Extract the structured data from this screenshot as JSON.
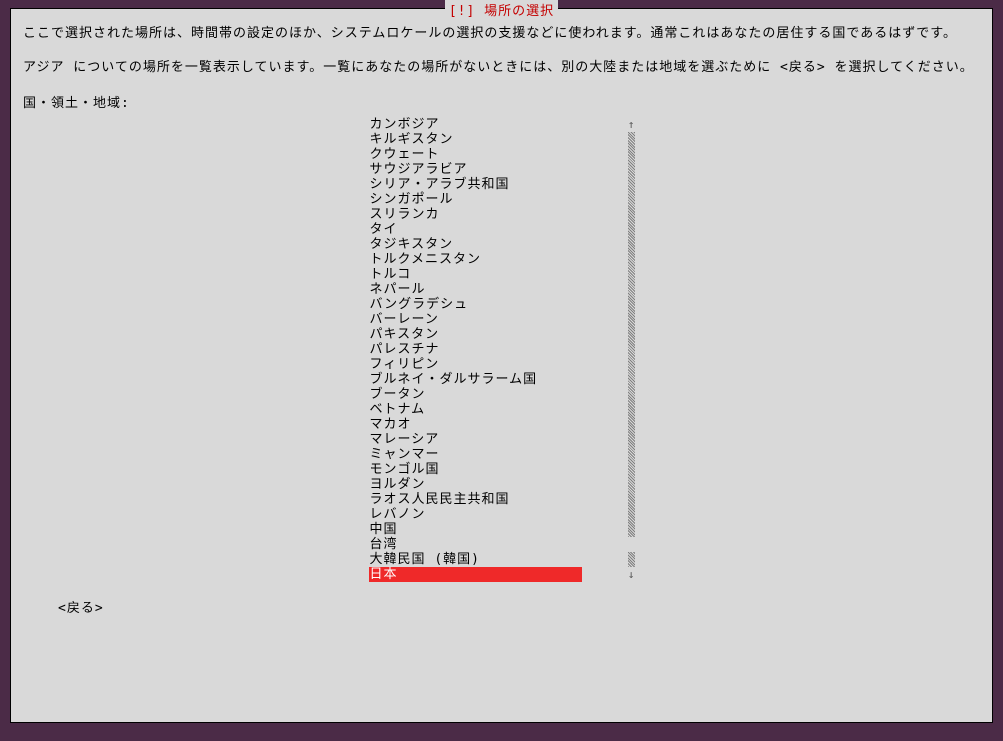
{
  "title": "[!] 場所の選択",
  "desc1": "ここで選択された場所は、時間帯の設定のほか、システムロケールの選択の支援などに使われます。通常これはあなたの居住する国であるはずです。",
  "desc2": "アジア についての場所を一覧表示しています。一覧にあなたの場所がないときには、別の大陸または地域を選ぶために <戻る> を選択してください。",
  "label": "国・領土・地域:",
  "items": [
    "カンボジア",
    "キルギスタン",
    "クウェート",
    "サウジアラビア",
    "シリア・アラブ共和国",
    "シンガポール",
    "スリランカ",
    "タイ",
    "タジキスタン",
    "トルクメニスタン",
    "トルコ",
    "ネパール",
    "バングラデシュ",
    "バーレーン",
    "パキスタン",
    "パレスチナ",
    "フィリピン",
    "ブルネイ・ダルサラーム国",
    "ブータン",
    "ベトナム",
    "マカオ",
    "マレーシア",
    "ミャンマー",
    "モンゴル国",
    "ヨルダン",
    "ラオス人民民主共和国",
    "レバノン",
    "中国",
    "台湾",
    "大韓民国 (韓国)",
    "日本"
  ],
  "selected_index": 30,
  "back": "<戻る>",
  "up": "↑",
  "down": "↓"
}
